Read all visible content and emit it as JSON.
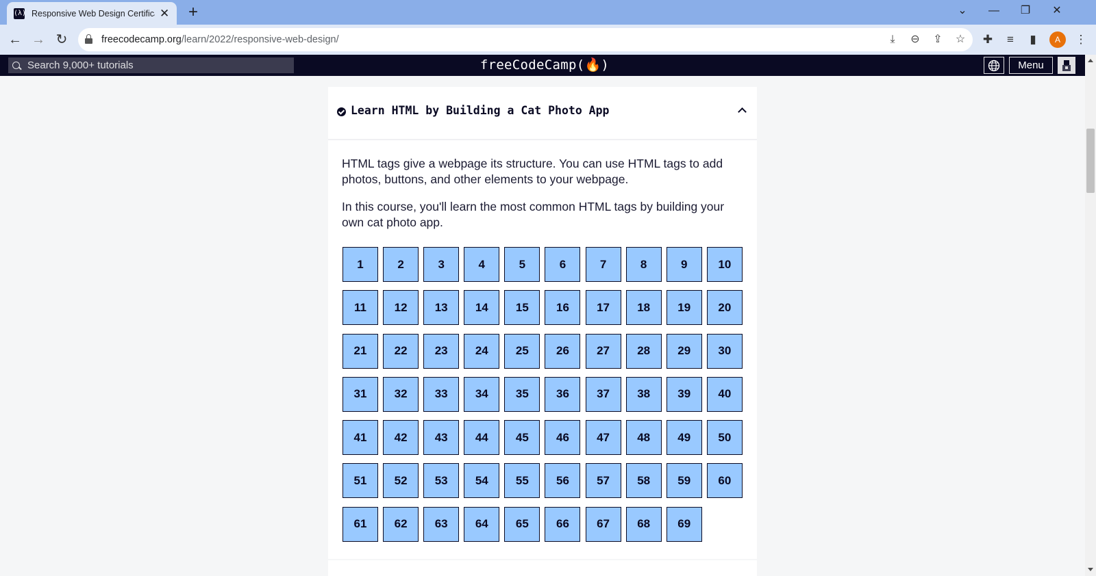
{
  "browser": {
    "tab_title": "Responsive Web Design Certification",
    "tab_favicon": "(λ)",
    "url_domain": "freecodecamp.org",
    "url_path": "/learn/2022/responsive-web-design/",
    "profile_initial": "A",
    "icons": [
      "back-icon",
      "forward-icon",
      "reload-icon",
      "lock-icon",
      "install-icon",
      "zoom-icon",
      "share-icon",
      "star-icon",
      "extensions-icon",
      "media-icon",
      "sidepanel-icon",
      "kebab-menu-icon"
    ]
  },
  "fcc_nav": {
    "search_placeholder": "Search 9,000+ tutorials",
    "logo": "freeCodeCamp(ὒ5)",
    "logo_text": "freeCodeCamp(🔥)",
    "menu_label": "Menu"
  },
  "block": {
    "title": "Learn HTML by Building a Cat Photo App",
    "desc_1": "HTML tags give a webpage its structure. You can use HTML tags to add photos, buttons, and other elements to your webpage.",
    "desc_2": "In this course, you'll learn the most common HTML tags by building your own cat photo app.",
    "step_count": 69
  },
  "colors": {
    "nav_bg": "#0a0a23",
    "step_bg": "#99c9ff",
    "tab_strip": "#8aaee8",
    "toolbar": "#dfe8f7",
    "avatar": "#e8710a"
  }
}
